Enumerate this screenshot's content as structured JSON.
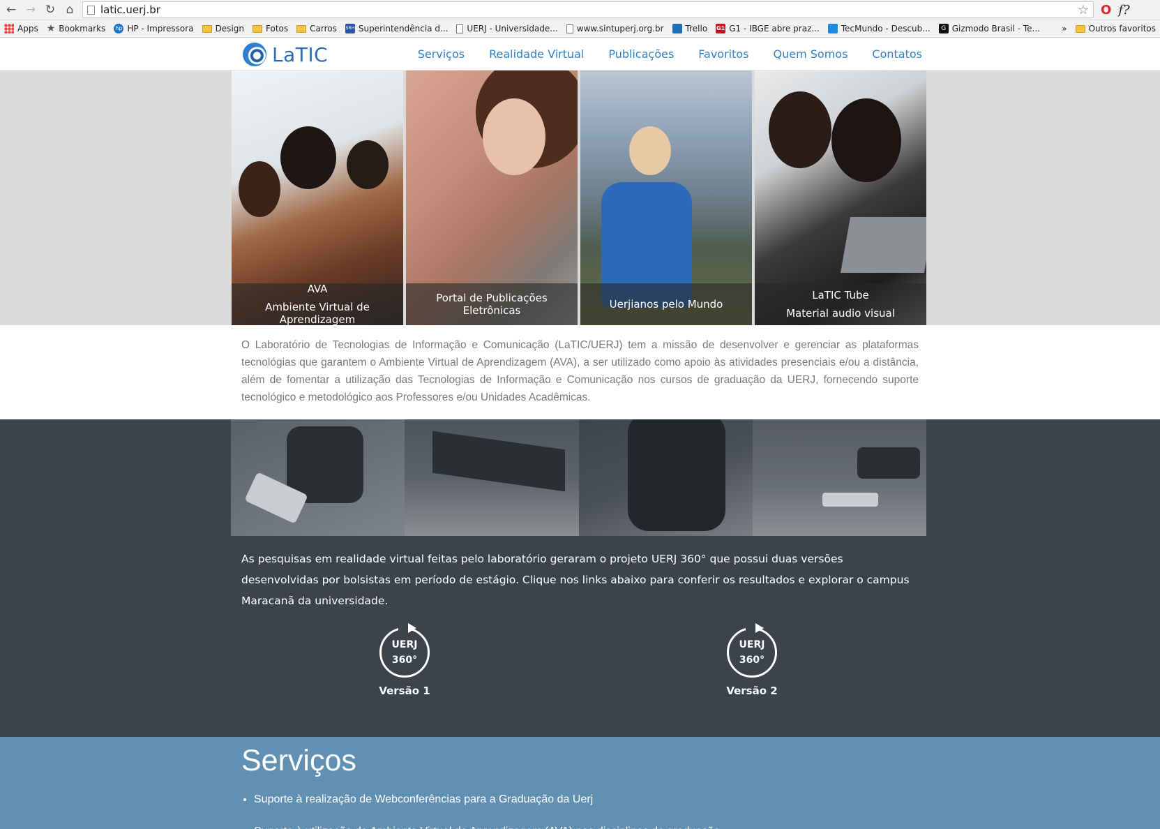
{
  "browser": {
    "url": "latic.uerj.br",
    "bookmarks": [
      {
        "label": "Apps",
        "icon": "apps-icon"
      },
      {
        "label": "Bookmarks",
        "icon": "star-icon"
      },
      {
        "label": "HP - Impressora",
        "icon": "hp-icon"
      },
      {
        "label": "Design",
        "icon": "folder-icon"
      },
      {
        "label": "Fotos",
        "icon": "folder-icon"
      },
      {
        "label": "Carros",
        "icon": "folder-icon"
      },
      {
        "label": "Superintendência d...",
        "icon": "srh-icon"
      },
      {
        "label": "UERJ - Universidade...",
        "icon": "page-icon"
      },
      {
        "label": "www.sintuperj.org.br",
        "icon": "page-icon"
      },
      {
        "label": "Trello",
        "icon": "trello-icon"
      },
      {
        "label": "G1 - IBGE abre praz...",
        "icon": "g1-icon"
      },
      {
        "label": "TecMundo - Descub...",
        "icon": "tecmundo-icon"
      },
      {
        "label": "Gizmodo Brasil - Te...",
        "icon": "gizmodo-icon"
      }
    ],
    "overflow": "»",
    "other_bookmarks": "Outros favoritos"
  },
  "site": {
    "logo": "LaTIC",
    "nav": [
      "Serviços",
      "Realidade Virtual",
      "Publicações",
      "Favoritos",
      "Quem Somos",
      "Contatos"
    ]
  },
  "tiles": [
    {
      "line1": "AVA",
      "line2": "Ambiente Virtual de Aprendizagem"
    },
    {
      "line1": "",
      "line2": "Portal de Publicações Eletrônicas"
    },
    {
      "line1": "",
      "line2": "Uerjianos pelo Mundo"
    },
    {
      "line1": "LaTIC Tube",
      "line2": "Material audio visual"
    }
  ],
  "intro": "O Laboratório de Tecnologias de Informação e Comunicação (LaTIC/UERJ) tem a missão de desenvolver e gerenciar as plataformas tecnológias que garantem o Ambiente Virtual de Aprendizagem (AVA), a ser utilizado como apoio às atividades presenciais e/ou a distância, além de fomentar a utilização das Tecnologias de Informação e Comunicação nos cursos de graduação da UERJ, fornecendo suporte tecnológico e metodológico aos Professores e/ou Unidades Acadêmicas.",
  "vr": {
    "text": "As pesquisas em realidade virtual feitas pelo laboratório geraram o projeto UERJ 360° que possui duas versões desenvolvidas por bolsistas em período de estágio. Clique nos links abaixo para conferir os resultados e explorar o campus Maracanã da universidade.",
    "badge_top": "UERJ",
    "badge_bottom": "360°",
    "v1": "Versão 1",
    "v2": "Versão 2"
  },
  "services": {
    "title": "Serviços",
    "items": [
      "Suporte à realização de Webconferências para a Graduação da Uerj",
      "Suporte à utilização do Ambiente Virtual de Aprendizagem (AVA) nas disciplinas de graduação"
    ]
  }
}
